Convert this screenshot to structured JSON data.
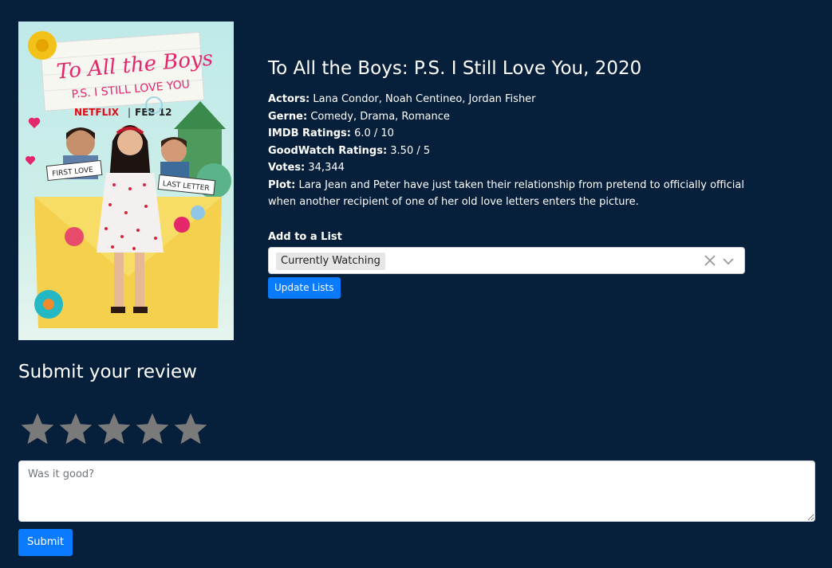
{
  "movie": {
    "title": "To All the Boys: P.S. I Still Love You, 2020",
    "poster": {
      "title_line1": "To All the Boys",
      "title_line2": "P.S. I STILL LOVE YOU",
      "brand": "NETFLIX",
      "date": "FEB 12",
      "tag_left": "FIRST LOVE",
      "tag_right": "LAST LETTER"
    },
    "details": [
      {
        "label": "Actors:",
        "value": "Lana Condor, Noah Centineo, Jordan Fisher"
      },
      {
        "label": "Gerne:",
        "value": "Comedy, Drama, Romance"
      },
      {
        "label": "IMDB Ratings:",
        "value": "6.0 / 10"
      },
      {
        "label": "GoodWatch Ratings:",
        "value": "3.50 / 5"
      },
      {
        "label": "Votes:",
        "value": "34,344"
      },
      {
        "label": "Plot:",
        "value": "Lara Jean and Peter have just taken their relationship from pretend to officially official when another recipient of one of her old love letters enters the picture."
      }
    ]
  },
  "lists": {
    "label": "Add to a List",
    "selected": "Currently Watching",
    "clear_icon": "close-icon",
    "dropdown_icon": "chevron-down-icon",
    "update_label": "Update Lists"
  },
  "review": {
    "heading": "Submit your review",
    "rating": 0,
    "max_rating": 5,
    "placeholder": "Was it good?",
    "submit_label": "Submit"
  },
  "colors": {
    "background": "#061f3b",
    "accent": "#0a7bff",
    "star_inactive": "#7a7a7a"
  }
}
